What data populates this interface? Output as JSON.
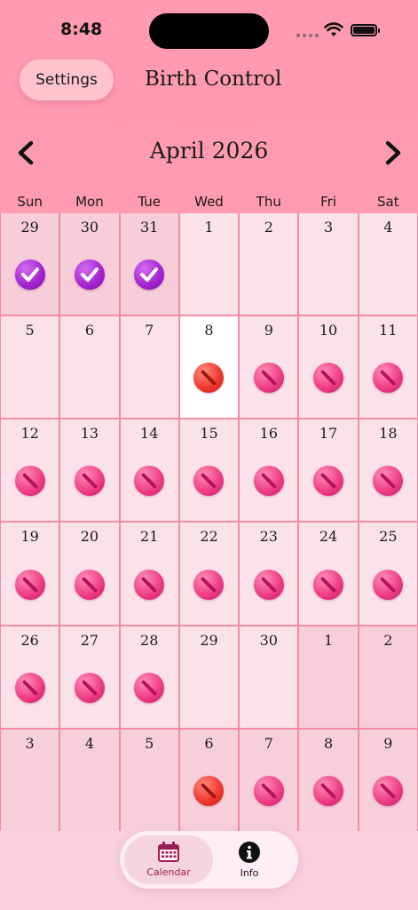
{
  "status": {
    "time": "8:48"
  },
  "header": {
    "settings_label": "Settings",
    "title": "Birth Control"
  },
  "calendar": {
    "month_title": "April 2026",
    "weekdays": [
      "Sun",
      "Mon",
      "Tue",
      "Wed",
      "Thu",
      "Fri",
      "Sat"
    ],
    "days": [
      {
        "n": "29",
        "kind": "prev",
        "mark": "check"
      },
      {
        "n": "30",
        "kind": "prev",
        "mark": "check"
      },
      {
        "n": "31",
        "kind": "prev",
        "mark": "check"
      },
      {
        "n": "1",
        "kind": "cur",
        "mark": ""
      },
      {
        "n": "2",
        "kind": "cur",
        "mark": ""
      },
      {
        "n": "3",
        "kind": "cur",
        "mark": ""
      },
      {
        "n": "4",
        "kind": "cur",
        "mark": ""
      },
      {
        "n": "5",
        "kind": "cur",
        "mark": ""
      },
      {
        "n": "6",
        "kind": "cur",
        "mark": ""
      },
      {
        "n": "7",
        "kind": "cur",
        "mark": ""
      },
      {
        "n": "8",
        "kind": "today",
        "mark": "pill-red"
      },
      {
        "n": "9",
        "kind": "cur",
        "mark": "pill"
      },
      {
        "n": "10",
        "kind": "cur",
        "mark": "pill"
      },
      {
        "n": "11",
        "kind": "cur",
        "mark": "pill"
      },
      {
        "n": "12",
        "kind": "cur",
        "mark": "pill"
      },
      {
        "n": "13",
        "kind": "cur",
        "mark": "pill"
      },
      {
        "n": "14",
        "kind": "cur",
        "mark": "pill"
      },
      {
        "n": "15",
        "kind": "cur",
        "mark": "pill"
      },
      {
        "n": "16",
        "kind": "cur",
        "mark": "pill"
      },
      {
        "n": "17",
        "kind": "cur",
        "mark": "pill"
      },
      {
        "n": "18",
        "kind": "cur",
        "mark": "pill"
      },
      {
        "n": "19",
        "kind": "cur",
        "mark": "pill"
      },
      {
        "n": "20",
        "kind": "cur",
        "mark": "pill"
      },
      {
        "n": "21",
        "kind": "cur",
        "mark": "pill"
      },
      {
        "n": "22",
        "kind": "cur",
        "mark": "pill"
      },
      {
        "n": "23",
        "kind": "cur",
        "mark": "pill"
      },
      {
        "n": "24",
        "kind": "cur",
        "mark": "pill"
      },
      {
        "n": "25",
        "kind": "cur",
        "mark": "pill"
      },
      {
        "n": "26",
        "kind": "cur",
        "mark": "pill"
      },
      {
        "n": "27",
        "kind": "cur",
        "mark": "pill"
      },
      {
        "n": "28",
        "kind": "cur",
        "mark": "pill"
      },
      {
        "n": "29",
        "kind": "cur",
        "mark": ""
      },
      {
        "n": "30",
        "kind": "cur",
        "mark": ""
      },
      {
        "n": "1",
        "kind": "next",
        "mark": ""
      },
      {
        "n": "2",
        "kind": "next",
        "mark": ""
      },
      {
        "n": "3",
        "kind": "next",
        "mark": ""
      },
      {
        "n": "4",
        "kind": "next",
        "mark": ""
      },
      {
        "n": "5",
        "kind": "next",
        "mark": ""
      },
      {
        "n": "6",
        "kind": "next",
        "mark": "pill-red"
      },
      {
        "n": "7",
        "kind": "next",
        "mark": "pill"
      },
      {
        "n": "8",
        "kind": "next",
        "mark": "pill"
      },
      {
        "n": "9",
        "kind": "next",
        "mark": "pill"
      }
    ]
  },
  "tabs": {
    "calendar_label": "Calendar",
    "info_label": "Info"
  },
  "colors": {
    "accent": "#9c1d56",
    "header": "#ff9ab0",
    "grid_line": "#f48ba6"
  }
}
